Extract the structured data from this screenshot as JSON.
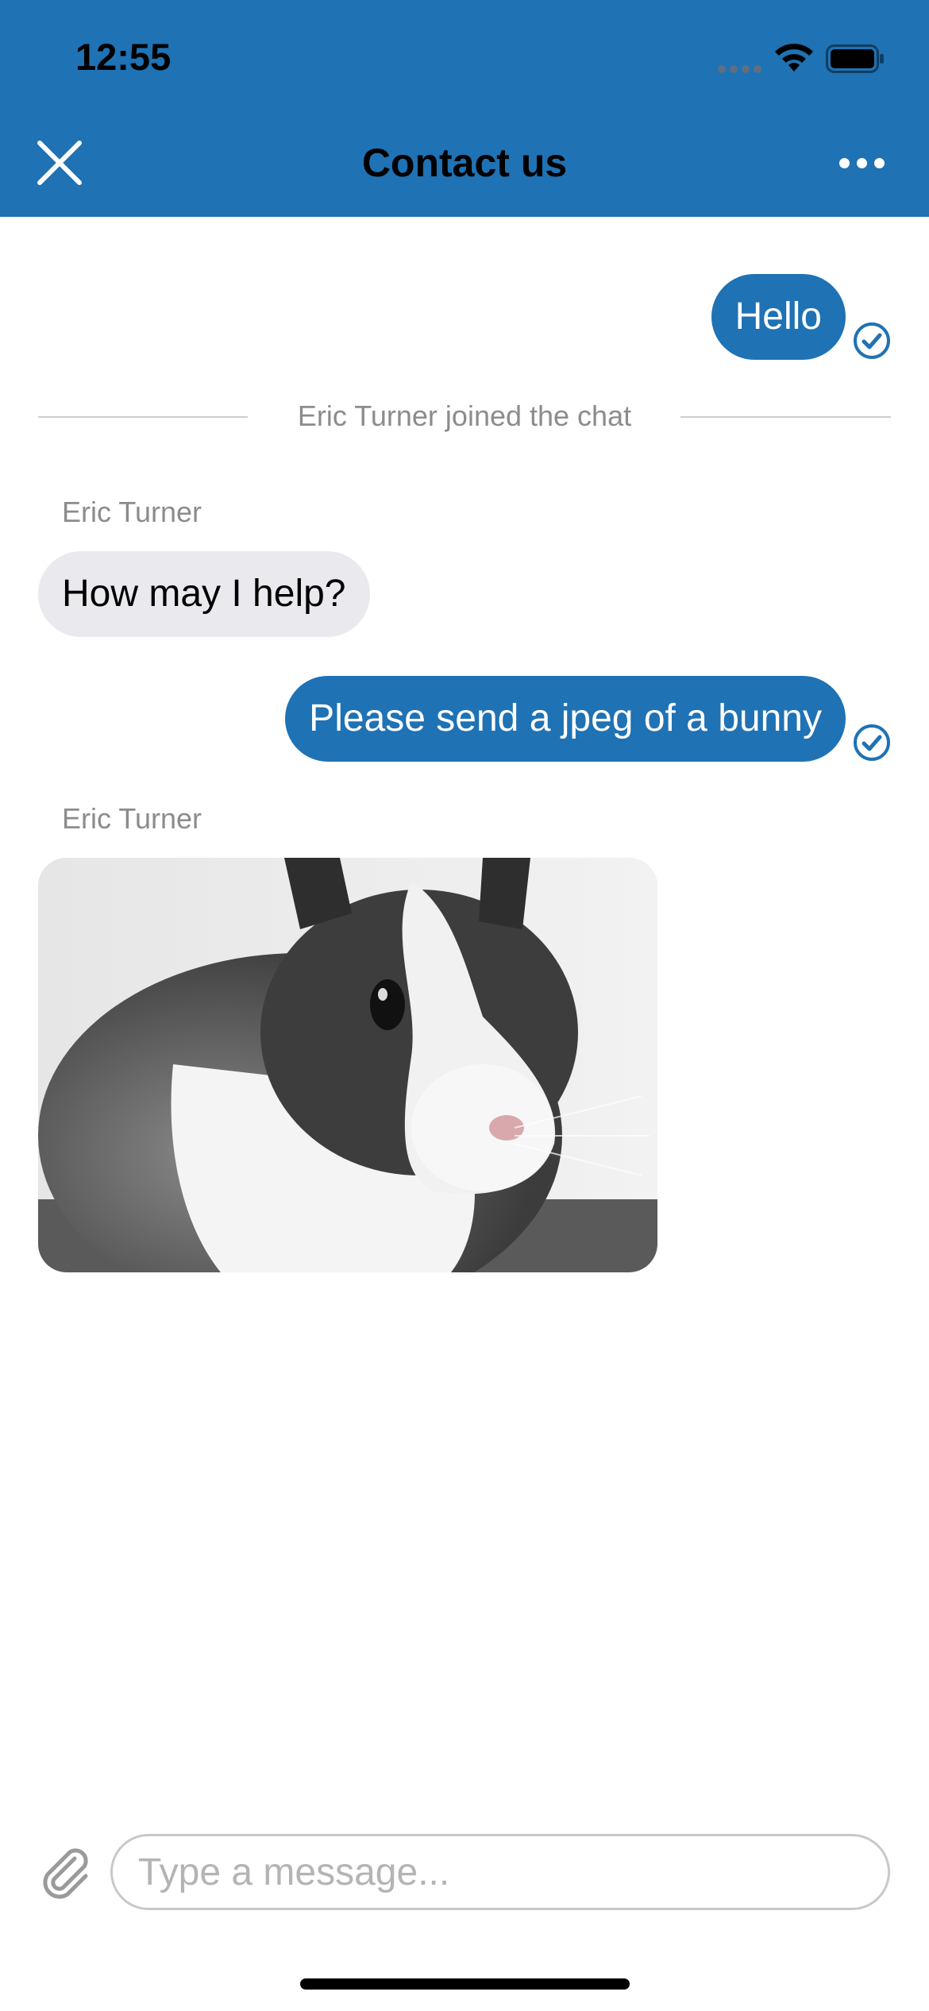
{
  "status_bar": {
    "time": "12:55",
    "icons": [
      "cellular-signal-icon",
      "wifi-icon",
      "battery-icon"
    ]
  },
  "header": {
    "title": "Contact us",
    "close_icon": "close-icon",
    "more_icon": "more-horizontal-icon"
  },
  "colors": {
    "brand": "#1f72b4",
    "incoming_bubble": "#e9e9ee",
    "muted_text": "#8c8c8c"
  },
  "messages": [
    {
      "type": "outgoing",
      "text": "Hello",
      "delivered": true
    },
    {
      "type": "system",
      "text": "Eric Turner joined the chat"
    },
    {
      "type": "incoming",
      "sender": "Eric Turner",
      "text": "How may I help?"
    },
    {
      "type": "outgoing",
      "text": "Please send a jpeg of a bunny",
      "delivered": true
    },
    {
      "type": "incoming_image",
      "sender": "Eric Turner",
      "image": "bunny-photo"
    }
  ],
  "composer": {
    "placeholder": "Type a message...",
    "value": "",
    "attach_icon": "paperclip-icon"
  }
}
